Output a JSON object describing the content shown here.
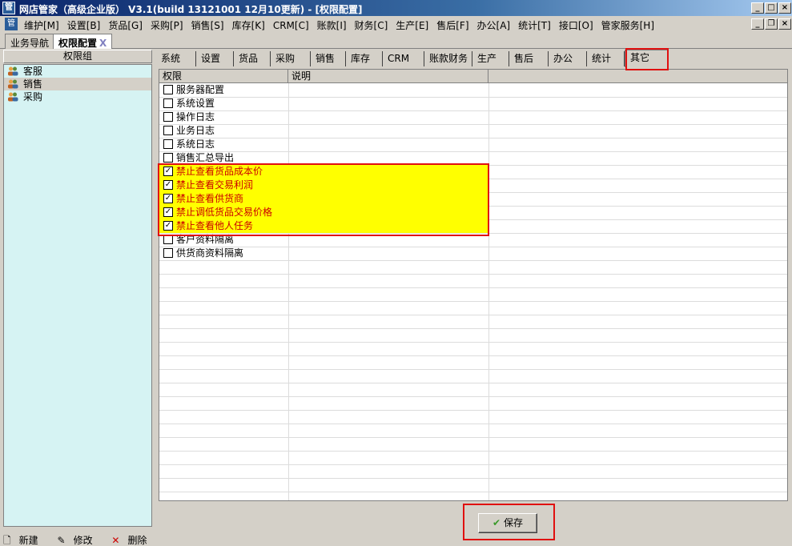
{
  "window": {
    "title": "网店管家（高级企业版） V3.1(build 13121001 12月10更新) - [权限配置]",
    "app_icon": "管"
  },
  "menu": {
    "icon": "管",
    "items": [
      "维护[M]",
      "设置[B]",
      "货品[G]",
      "采购[P]",
      "销售[S]",
      "库存[K]",
      "CRM[C]",
      "账款[I]",
      "财务[C]",
      "生产[E]",
      "售后[F]",
      "办公[A]",
      "统计[T]",
      "接口[O]",
      "管家服务[H]"
    ]
  },
  "doc_tabs": [
    {
      "label": "业务导航"
    },
    {
      "label": "权限配置",
      "close": "X"
    }
  ],
  "left_panel": {
    "header": "权限组",
    "groups": [
      "客服",
      "销售",
      "采购"
    ],
    "footer": [
      "新建",
      "修改",
      "删除"
    ]
  },
  "module_tabs": [
    "系统",
    "设置",
    "货品",
    "采购",
    "销售",
    "库存",
    "CRM",
    "账款财务",
    "生产",
    "售后",
    "办公",
    "统计",
    "其它"
  ],
  "grid": {
    "columns": [
      "权限",
      "说明"
    ],
    "rows": [
      {
        "label": "服务器配置",
        "checked": false
      },
      {
        "label": "系统设置",
        "checked": false
      },
      {
        "label": "操作日志",
        "checked": false
      },
      {
        "label": "业务日志",
        "checked": false
      },
      {
        "label": "系统日志",
        "checked": false
      },
      {
        "label": "销售汇总导出",
        "checked": false
      },
      {
        "label": "禁止查看货品成本价",
        "checked": true
      },
      {
        "label": "禁止查看交易利润",
        "checked": true
      },
      {
        "label": "禁止查看供货商",
        "checked": true
      },
      {
        "label": "禁止调低货品交易价格",
        "checked": true
      },
      {
        "label": "禁止查看他人任务",
        "checked": true
      },
      {
        "label": "客户资料隔离",
        "checked": false
      },
      {
        "label": "供货商资料隔离",
        "checked": false
      }
    ]
  },
  "save_label": "保存",
  "colors": {
    "highlight": "#ffff00",
    "highlight_text": "#cc0000",
    "annotation": "#e01010",
    "list_bg": "#d6f3f3"
  }
}
